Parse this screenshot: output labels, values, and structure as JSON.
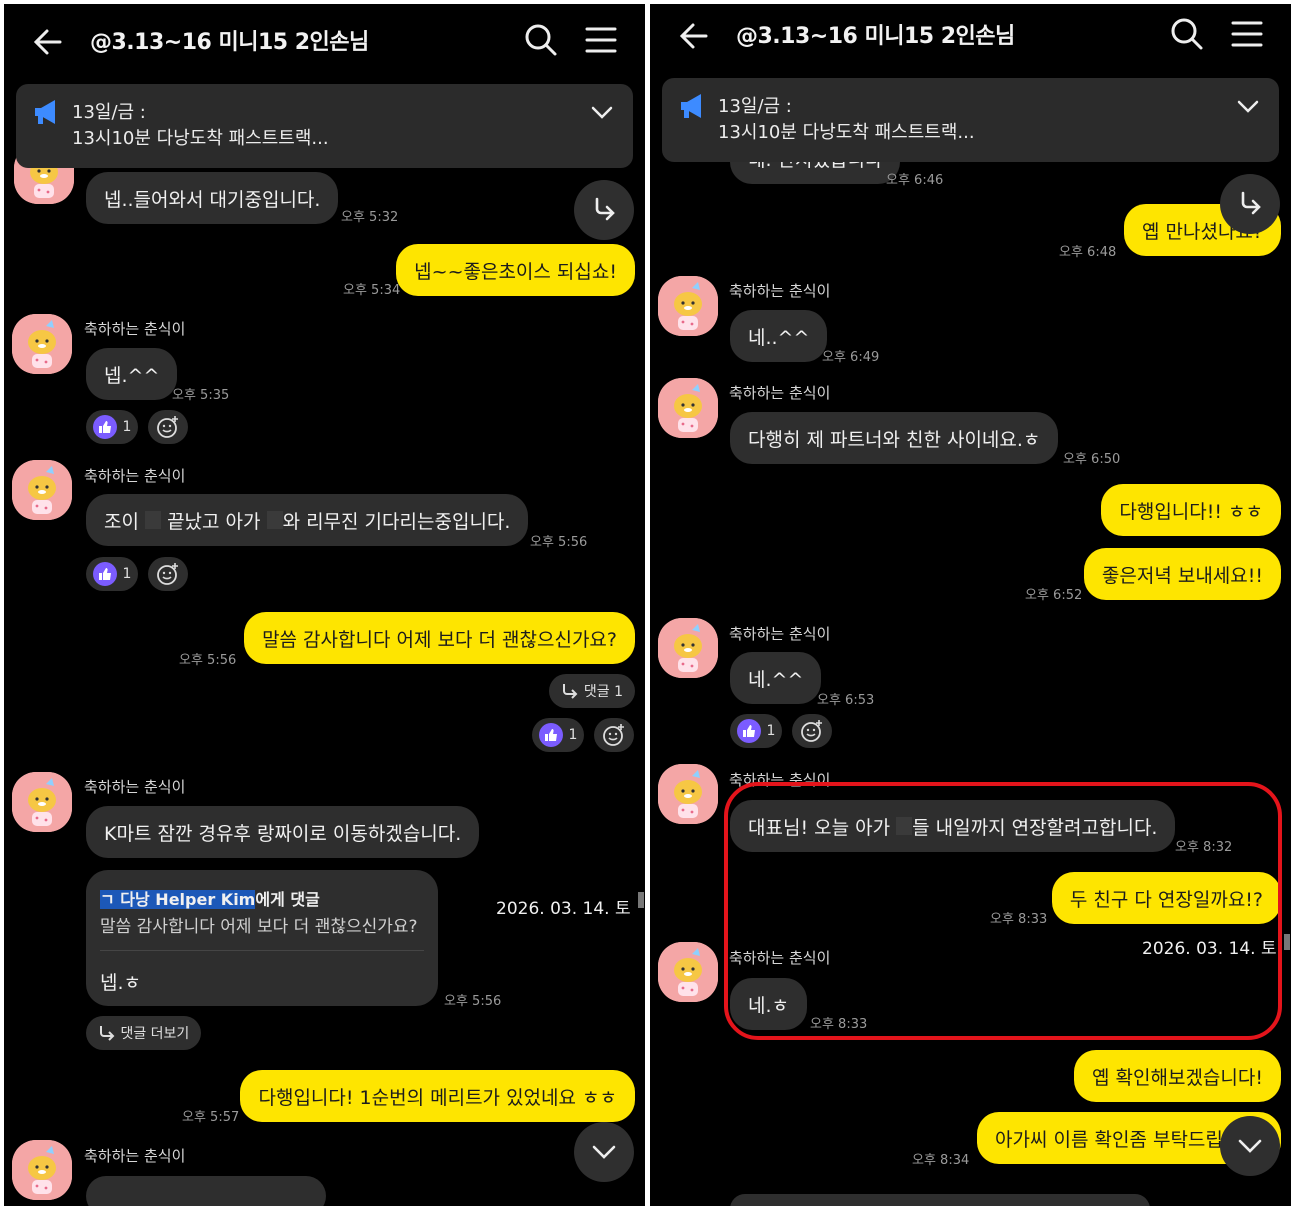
{
  "header": {
    "title": "@3.13~16 미니15 2인손님"
  },
  "notice": {
    "line1": "13일/금 :",
    "line2": "13시10분 다낭도착 패스트트랙..."
  },
  "sender": {
    "name": "축하하는 춘식이"
  },
  "left": {
    "m1": {
      "text": "넵..들어와서 대기중입니다.",
      "time": "오후 5:32"
    },
    "m2": {
      "text": "넵~~좋은초이스 되십쇼!",
      "time": "오후 5:34"
    },
    "m3": {
      "text": "넵.^^",
      "time": "오후 5:35",
      "likes": "1"
    },
    "m4": {
      "text_a": "조이",
      "text_b": "끝났고 아가",
      "text_c": "와 리무진 기다리는중입니다.",
      "time": "오후 5:56",
      "likes": "1"
    },
    "m5": {
      "text": "말씀 감사합니다 어제 보다 더 괜찮으신가요?",
      "time": "오후 5:56",
      "reply_chip": "댓글 1",
      "likes": "1"
    },
    "m6": {
      "text": "K마트 잠깐 경유후 랑짜이로 이동하겠습니다."
    },
    "reply": {
      "who": "ㄱ 다낭 Helper Kim",
      "suffix": "에게 댓글",
      "quote": "말씀 감사합니다 어제 보다 더 괜찮으신가요?",
      "answer": "넵.ㅎ",
      "time": "오후 5:56",
      "more": "댓글 더보기"
    },
    "date_tip": "2026. 03. 14. 토",
    "m7": {
      "text": "다행입니다! 1순번의 메리트가 있었네요 ㅎㅎ",
      "time": "오후 5:57"
    }
  },
  "right": {
    "m0": {
      "text": "네. 만지겠습니다",
      "time": "오후 6:46"
    },
    "m1": {
      "text": "옙 만나셨나요?",
      "time": "오후 6:48"
    },
    "m2": {
      "text": "네..^^",
      "time": "오후 6:49"
    },
    "m3": {
      "text": "다행히 제 파트너와 친한 사이네요.ㅎ",
      "time": "오후 6:50"
    },
    "m4": {
      "text": "다행입니다!! ㅎㅎ"
    },
    "m5": {
      "text": "좋은저녁 보내세요!!",
      "time": "오후 6:52"
    },
    "m6": {
      "text": "네.^^",
      "time": "오후 6:53",
      "likes": "1"
    },
    "m7": {
      "text_a": "대표님! 오늘 아가",
      "text_b": "들 내일까지 연장할려고합니다.",
      "time": "오후 8:32"
    },
    "m8": {
      "text": "두 친구 다 연장일까요!?",
      "time": "오후 8:33"
    },
    "date_tip": "2026. 03. 14. 토",
    "m9": {
      "text": "네.ㅎ",
      "time": "오후 8:33"
    },
    "m10": {
      "text": "옙 확인해보겠습니다!"
    },
    "m11": {
      "text": "아가씨 이름 확인좀 부탁드립니다",
      "time": "오후 8:34"
    }
  },
  "colors": {
    "bg": "#000000",
    "bubble_other": "#2e2e2e",
    "bubble_mine": "#fee500",
    "highlight": "#e4141b",
    "like": "#7b5cff"
  },
  "icons": [
    "back-arrow-icon",
    "search-icon",
    "menu-icon",
    "megaphone-icon",
    "chevron-down-icon",
    "share-icon",
    "thumbs-up-icon",
    "add-emoji-icon",
    "reply-arrow-icon",
    "scroll-down-icon",
    "avatar-choonsik-icon"
  ]
}
